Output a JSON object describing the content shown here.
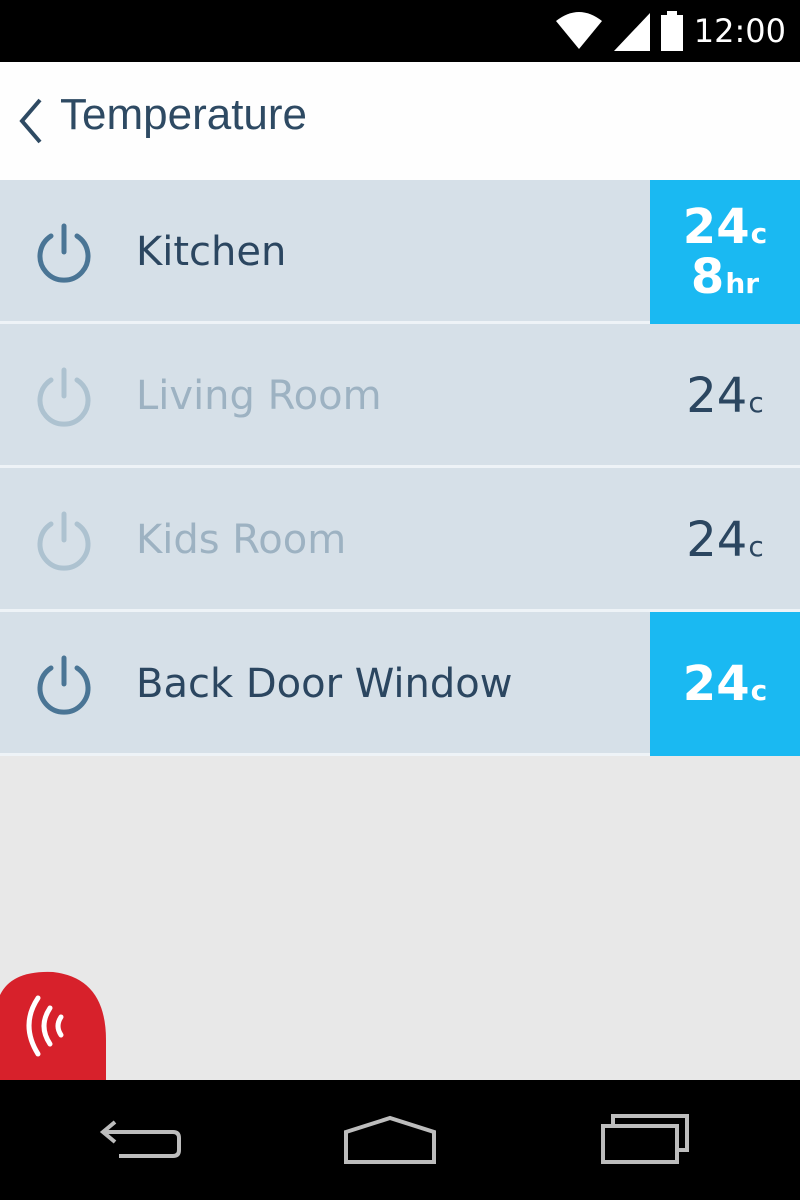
{
  "status_bar": {
    "time": "12:00",
    "icons": [
      "wifi-icon",
      "signal-icon",
      "battery-icon"
    ]
  },
  "header": {
    "back_icon": "chevron-left-icon",
    "title": "Temperature"
  },
  "rooms": [
    {
      "name": "Kitchen",
      "state": "active",
      "temp": "24",
      "temp_unit": "c",
      "duration": "8",
      "duration_unit": "hr"
    },
    {
      "name": "Living Room",
      "state": "inactive",
      "temp": "24",
      "temp_unit": "c"
    },
    {
      "name": "Kids Room",
      "state": "inactive",
      "temp": "24",
      "temp_unit": "c"
    },
    {
      "name": "Back Door Window",
      "state": "active",
      "temp": "24",
      "temp_unit": "c"
    }
  ],
  "alarm_button": {
    "icon": "alarm-waves-icon",
    "color": "#d7212b"
  },
  "nav_bar": {
    "icons": [
      "back-icon",
      "home-icon",
      "recents-icon"
    ]
  },
  "colors": {
    "accent": "#1ab9f2",
    "row_bg": "#d6e0e8",
    "text_dark": "#2b4660",
    "text_muted": "#9db2c2"
  }
}
